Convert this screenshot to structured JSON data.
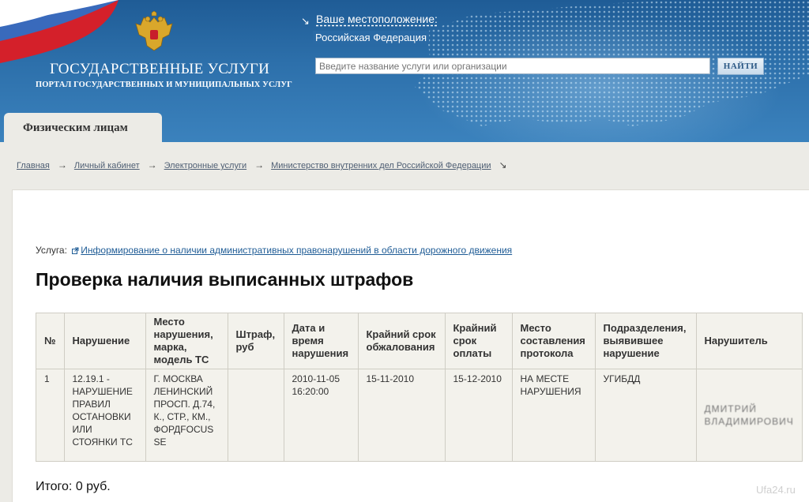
{
  "header": {
    "logo_title": "ГОСУДАРСТВЕННЫЕ УСЛУГИ",
    "logo_subtitle": "ПОРТАЛ ГОСУДАРСТВЕННЫХ И МУНИЦИПАЛЬНЫХ УСЛУГ",
    "location_label": "Ваше местоположение:",
    "location_value": "Российская Федерация",
    "search_placeholder": "Введите название услуги или организации",
    "search_button": "НАЙТИ",
    "colors": {
      "header_top": "#1f5c96",
      "header_bottom": "#3b82bd"
    }
  },
  "tabs": {
    "active": "Физическим лицам"
  },
  "breadcrumb": [
    "Главная",
    "Личный кабинет",
    "Электронные услуги",
    "Министерство внутренних дел Российской Федерации"
  ],
  "service": {
    "label": "Услуга:",
    "link": "Информирование о наличии административных правонарушений в области дорожного движения"
  },
  "page_title": "Проверка наличия выписанных штрафов",
  "table": {
    "headers": [
      "№",
      "Нарушение",
      "Место нарушения, марка, модель ТС",
      "Штраф, руб",
      "Дата и время нарушения",
      "Крайний срок обжалования",
      "Крайний срок оплаты",
      "Место составления протокола",
      "Подразделения, выявившее нарушение",
      "Нарушитель"
    ],
    "rows": [
      [
        "1",
        "12.19.1 - НАРУШЕНИЕ ПРАВИЛ ОСТАНОВКИ ИЛИ СТОЯНКИ ТС",
        "Г. МОСКВА ЛЕНИНСКИЙ ПРОСП. Д.74, К., СТР., КМ., ФОРДFOCUS SE",
        "",
        "2010-11-05 16:20:00",
        "15-11-2010",
        "15-12-2010",
        "НА МЕСТЕ НАРУШЕНИЯ",
        "УГИБДД",
        "ДМИТРИЙ ВЛАДИМИРОВИЧ"
      ]
    ]
  },
  "total": "Итого: 0 руб.",
  "watermark": "Ufa24.ru"
}
